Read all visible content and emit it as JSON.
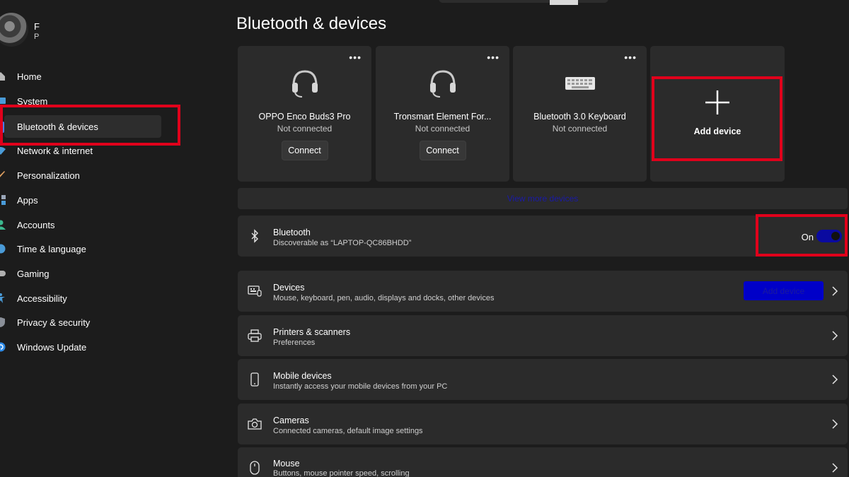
{
  "page": {
    "title": "Bluetooth & devices"
  },
  "user": {
    "name": "F",
    "sub": "P"
  },
  "sidebar": {
    "items": [
      {
        "label": "Home",
        "icon": "home-icon"
      },
      {
        "label": "System",
        "icon": "system-icon"
      },
      {
        "label": "Bluetooth & devices",
        "icon": "bluetooth-icon",
        "active": true
      },
      {
        "label": "Network & internet",
        "icon": "wifi-icon"
      },
      {
        "label": "Personalization",
        "icon": "brush-icon"
      },
      {
        "label": "Apps",
        "icon": "apps-icon"
      },
      {
        "label": "Accounts",
        "icon": "person-icon"
      },
      {
        "label": "Time & language",
        "icon": "globe-icon"
      },
      {
        "label": "Gaming",
        "icon": "gamepad-icon"
      },
      {
        "label": "Accessibility",
        "icon": "accessibility-icon"
      },
      {
        "label": "Privacy & security",
        "icon": "shield-icon"
      },
      {
        "label": "Windows Update",
        "icon": "update-icon"
      }
    ]
  },
  "devices": [
    {
      "name": "OPPO Enco Buds3 Pro",
      "status": "Not connected",
      "action": "Connect",
      "icon": "headset-icon"
    },
    {
      "name": "Tronsmart Element For...",
      "status": "Not connected",
      "action": "Connect",
      "icon": "headset-icon"
    },
    {
      "name": "Bluetooth 3.0 Keyboard",
      "status": "Not connected",
      "icon": "keyboard-icon"
    }
  ],
  "add_card": {
    "label": "Add device"
  },
  "view_more": {
    "label": "View more devices"
  },
  "bluetooth": {
    "title": "Bluetooth",
    "subtitle": "Discoverable as “LAPTOP-QC86BHDD”",
    "state_label": "On",
    "enabled": true
  },
  "settings_rows": [
    {
      "title": "Devices",
      "subtitle": "Mouse, keyboard, pen, audio, displays and docks, other devices",
      "icon": "devices-icon",
      "button": "Add device"
    },
    {
      "title": "Printers & scanners",
      "subtitle": "Preferences",
      "icon": "printer-icon"
    },
    {
      "title": "Mobile devices",
      "subtitle": "Instantly access your mobile devices from your PC",
      "icon": "phone-icon"
    },
    {
      "title": "Cameras",
      "subtitle": "Connected cameras, default image settings",
      "icon": "camera-icon"
    },
    {
      "title": "Mouse",
      "subtitle": "Buttons, mouse pointer speed, scrolling",
      "icon": "mouse-icon"
    }
  ],
  "colors": {
    "background": "#1c1c1c",
    "card": "#2b2b2b",
    "accent": "#0000c8",
    "highlight": "#e0001b"
  }
}
